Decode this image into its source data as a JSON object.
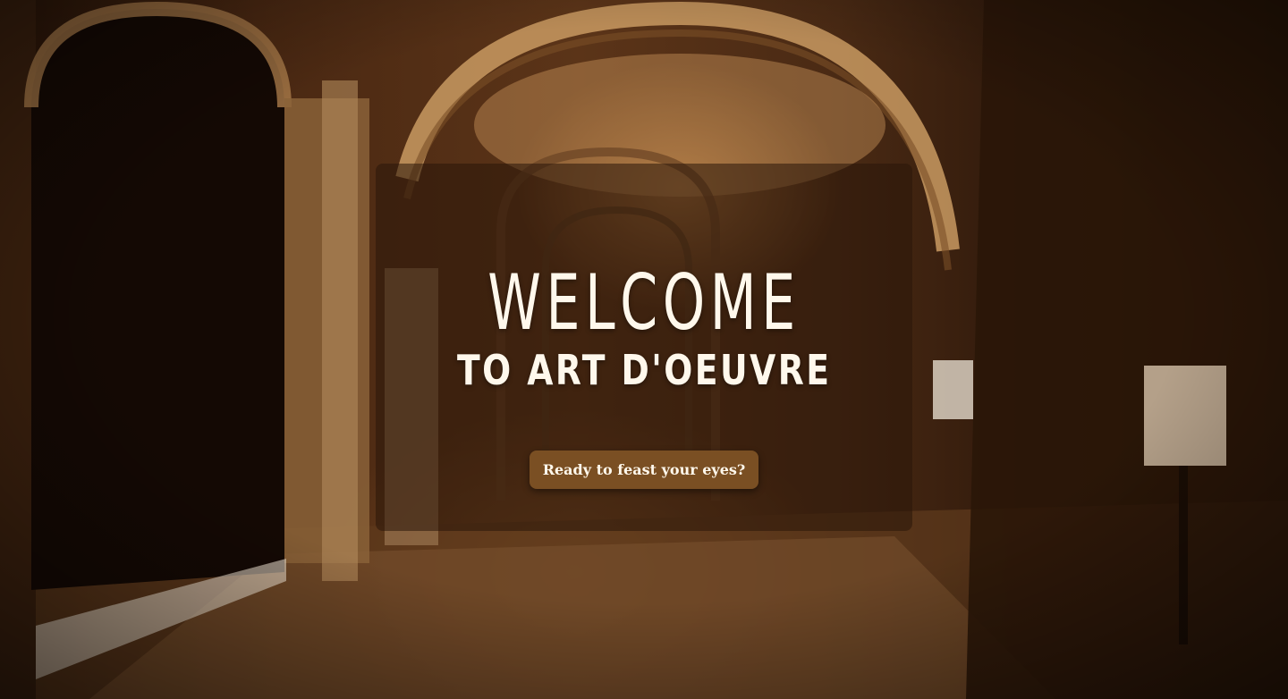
{
  "hero": {
    "title": "WELCOME",
    "subtitle": "TO ART D'OEUVRE",
    "cta_label": "Ready to feast your eyes?",
    "background_image": "stone archway cloister corridor, warm amber light",
    "overlay_color": "#2a160a",
    "button_color": "#7a4f23",
    "text_color": "#fff8ec"
  }
}
